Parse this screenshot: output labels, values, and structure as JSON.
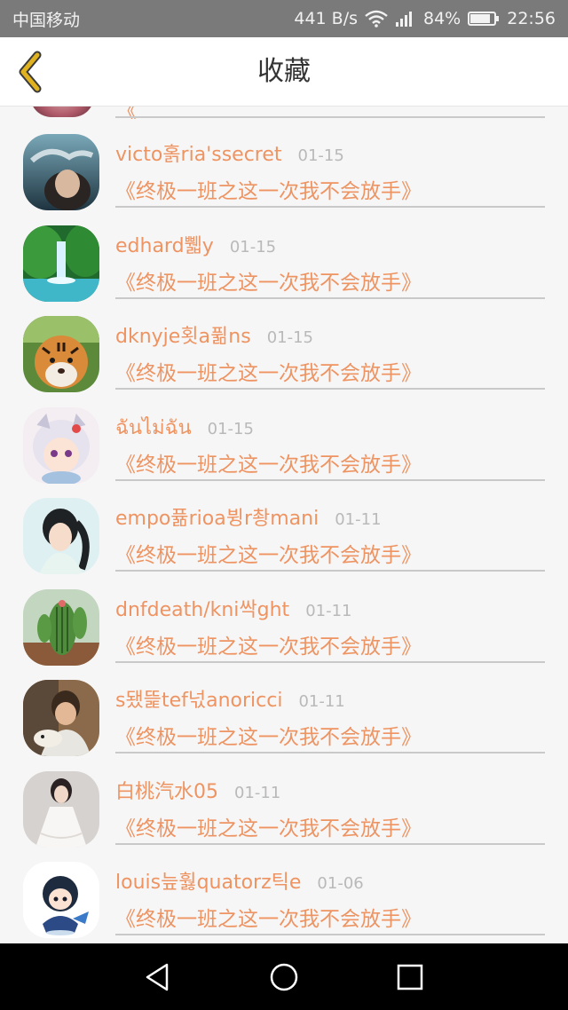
{
  "status_bar": {
    "carrier": "中国移动",
    "network_speed": "441 B/s",
    "battery": "84%",
    "time": "22:56",
    "icons": [
      "wifi-icon",
      "signal-icon",
      "battery-icon"
    ]
  },
  "header": {
    "title": "收藏",
    "back_icon": "chevron-left-icon"
  },
  "colors": {
    "accent": "#ee9462",
    "date": "#b9b9b9",
    "divider": "#c9c9c9",
    "back_icon": "#e0b220"
  },
  "partial_item": {
    "title": "《"
  },
  "favorites": [
    {
      "username": "victo홁ria'ssecret",
      "date": "01-15",
      "title": "《终极一班之这一次我不会放手》",
      "avatar": "avatar-smoke"
    },
    {
      "username": "edhard쀏y",
      "date": "01-15",
      "title": "《终极一班之这一次我不会放手》",
      "avatar": "avatar-waterfall"
    },
    {
      "username": "dknyje횟a퓖ns",
      "date": "01-15",
      "title": "《终极一班之这一次我不会放手》",
      "avatar": "avatar-tiger"
    },
    {
      "username": "ฉันไม่ฉัน",
      "date": "01-15",
      "title": "《终极一班之这一次我不会放手》",
      "avatar": "avatar-anime-girl"
    },
    {
      "username": "empo퓲rioa뷩r촹mani",
      "date": "01-11",
      "title": "《终极一班之这一次我不会放手》",
      "avatar": "avatar-ponytail"
    },
    {
      "username": "dnfdeath/kni싹ght",
      "date": "01-11",
      "title": "《终极一班之这一次我不会放手》",
      "avatar": "avatar-cactus"
    },
    {
      "username": "s됐뜵tef넋anoricci",
      "date": "01-11",
      "title": "《终极一班之这一次我不会放手》",
      "avatar": "avatar-boy-dog"
    },
    {
      "username": "白桃汽水05",
      "date": "01-11",
      "title": "《终极一班之这一次我不会放手》",
      "avatar": "avatar-white-dress"
    },
    {
      "username": "louis늪훯quatorz틱e",
      "date": "01-06",
      "title": "《终极一班之这一次我不会放手》",
      "avatar": "avatar-chibi"
    }
  ],
  "nav_bar": {
    "back": "triangle-back-icon",
    "home": "circle-home-icon",
    "recents": "square-recents-icon"
  }
}
